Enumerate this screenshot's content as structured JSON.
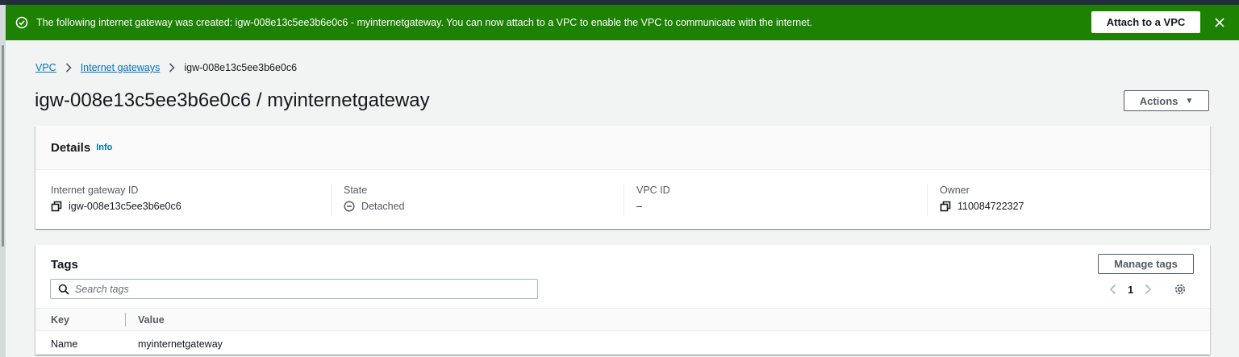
{
  "flash": {
    "message": "The following internet gateway was created: igw-008e13c5ee3b6e0c6 - myinternetgateway. You can now attach to a VPC to enable the VPC to communicate with the internet.",
    "action_label": "Attach to a VPC",
    "color": "#1d8102"
  },
  "breadcrumb": {
    "items": [
      "VPC",
      "Internet gateways"
    ],
    "current": "igw-008e13c5ee3b6e0c6"
  },
  "page": {
    "title": "igw-008e13c5ee3b6e0c6 / myinternetgateway",
    "actions_label": "Actions",
    "actions_caret": "▼"
  },
  "details": {
    "title": "Details",
    "info_label": "Info",
    "fields": [
      {
        "label": "Internet gateway ID",
        "value": "igw-008e13c5ee3b6e0c6",
        "icon": "copy-icon"
      },
      {
        "label": "State",
        "value": "Detached",
        "icon": "minus-circle-icon"
      },
      {
        "label": "VPC ID",
        "value": "–"
      },
      {
        "label": "Owner",
        "value": "110084722327",
        "icon": "copy-icon"
      }
    ]
  },
  "tags": {
    "title": "Tags",
    "manage_label": "Manage tags",
    "search_placeholder": "Search tags",
    "page_number": "1",
    "columns": [
      "Key",
      "Value"
    ],
    "rows": [
      {
        "key": "Name",
        "value": "myinternetgateway"
      }
    ]
  },
  "colors": {
    "accent_link": "#0073bb",
    "success": "#1d8102"
  }
}
